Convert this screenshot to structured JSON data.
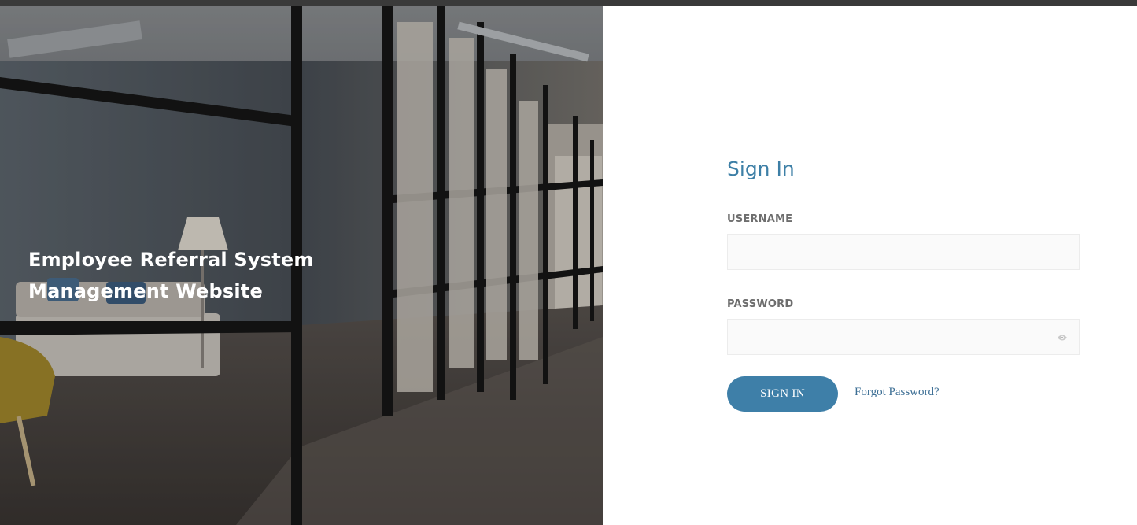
{
  "hero": {
    "title_line1": "Employee Referral System",
    "title_line2": "Management Website"
  },
  "form": {
    "heading": "Sign In",
    "username": {
      "label": "USERNAME",
      "value": "",
      "placeholder": ""
    },
    "password": {
      "label": "PASSWORD",
      "value": "",
      "placeholder": ""
    },
    "submit_label": "SIGN IN",
    "forgot_label": "Forgot Password?"
  },
  "icons": {
    "password_toggle": "eye-icon"
  },
  "colors": {
    "accent": "#3e7fa8",
    "heading": "#3d7fa6",
    "link": "#3d6f95",
    "label": "#6e6e6e",
    "field_bg": "#fafafa",
    "top_bar": "#3a3a3a"
  }
}
